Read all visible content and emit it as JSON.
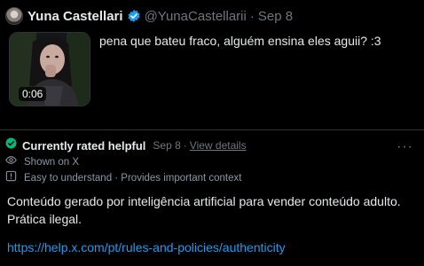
{
  "tweet": {
    "author_name": "Yuna Castellari",
    "handle": "@YunaCastellarii",
    "separator": "·",
    "date": "Sep 8",
    "text": "pena que bateu fraco, alguém ensina eles aguii? :3",
    "video_duration": "0:06",
    "icons": {
      "verified": "verified-badge-icon",
      "avatar": "avatar"
    },
    "colors": {
      "verified": "#1d9bf0"
    }
  },
  "note": {
    "title": "Currently rated helpful",
    "date": "Sep 8",
    "separator": "·",
    "view_details": "View details",
    "shown_on": "Shown on X",
    "tags": "Easy to understand · Provides important context",
    "body": "Conteúdo gerado por inteligência artificial para vender conteúdo adulto. Prática ilegal.",
    "link": "https://help.x.com/pt/rules-and-policies/authenticity",
    "more": "···",
    "icons": {
      "status": "check-circle-icon",
      "shown": "eye-icon",
      "tags": "info-icon",
      "more": "more-icon"
    },
    "colors": {
      "helpful": "#00ba7c",
      "link": "#1d9bf0",
      "muted": "#71767b"
    }
  }
}
